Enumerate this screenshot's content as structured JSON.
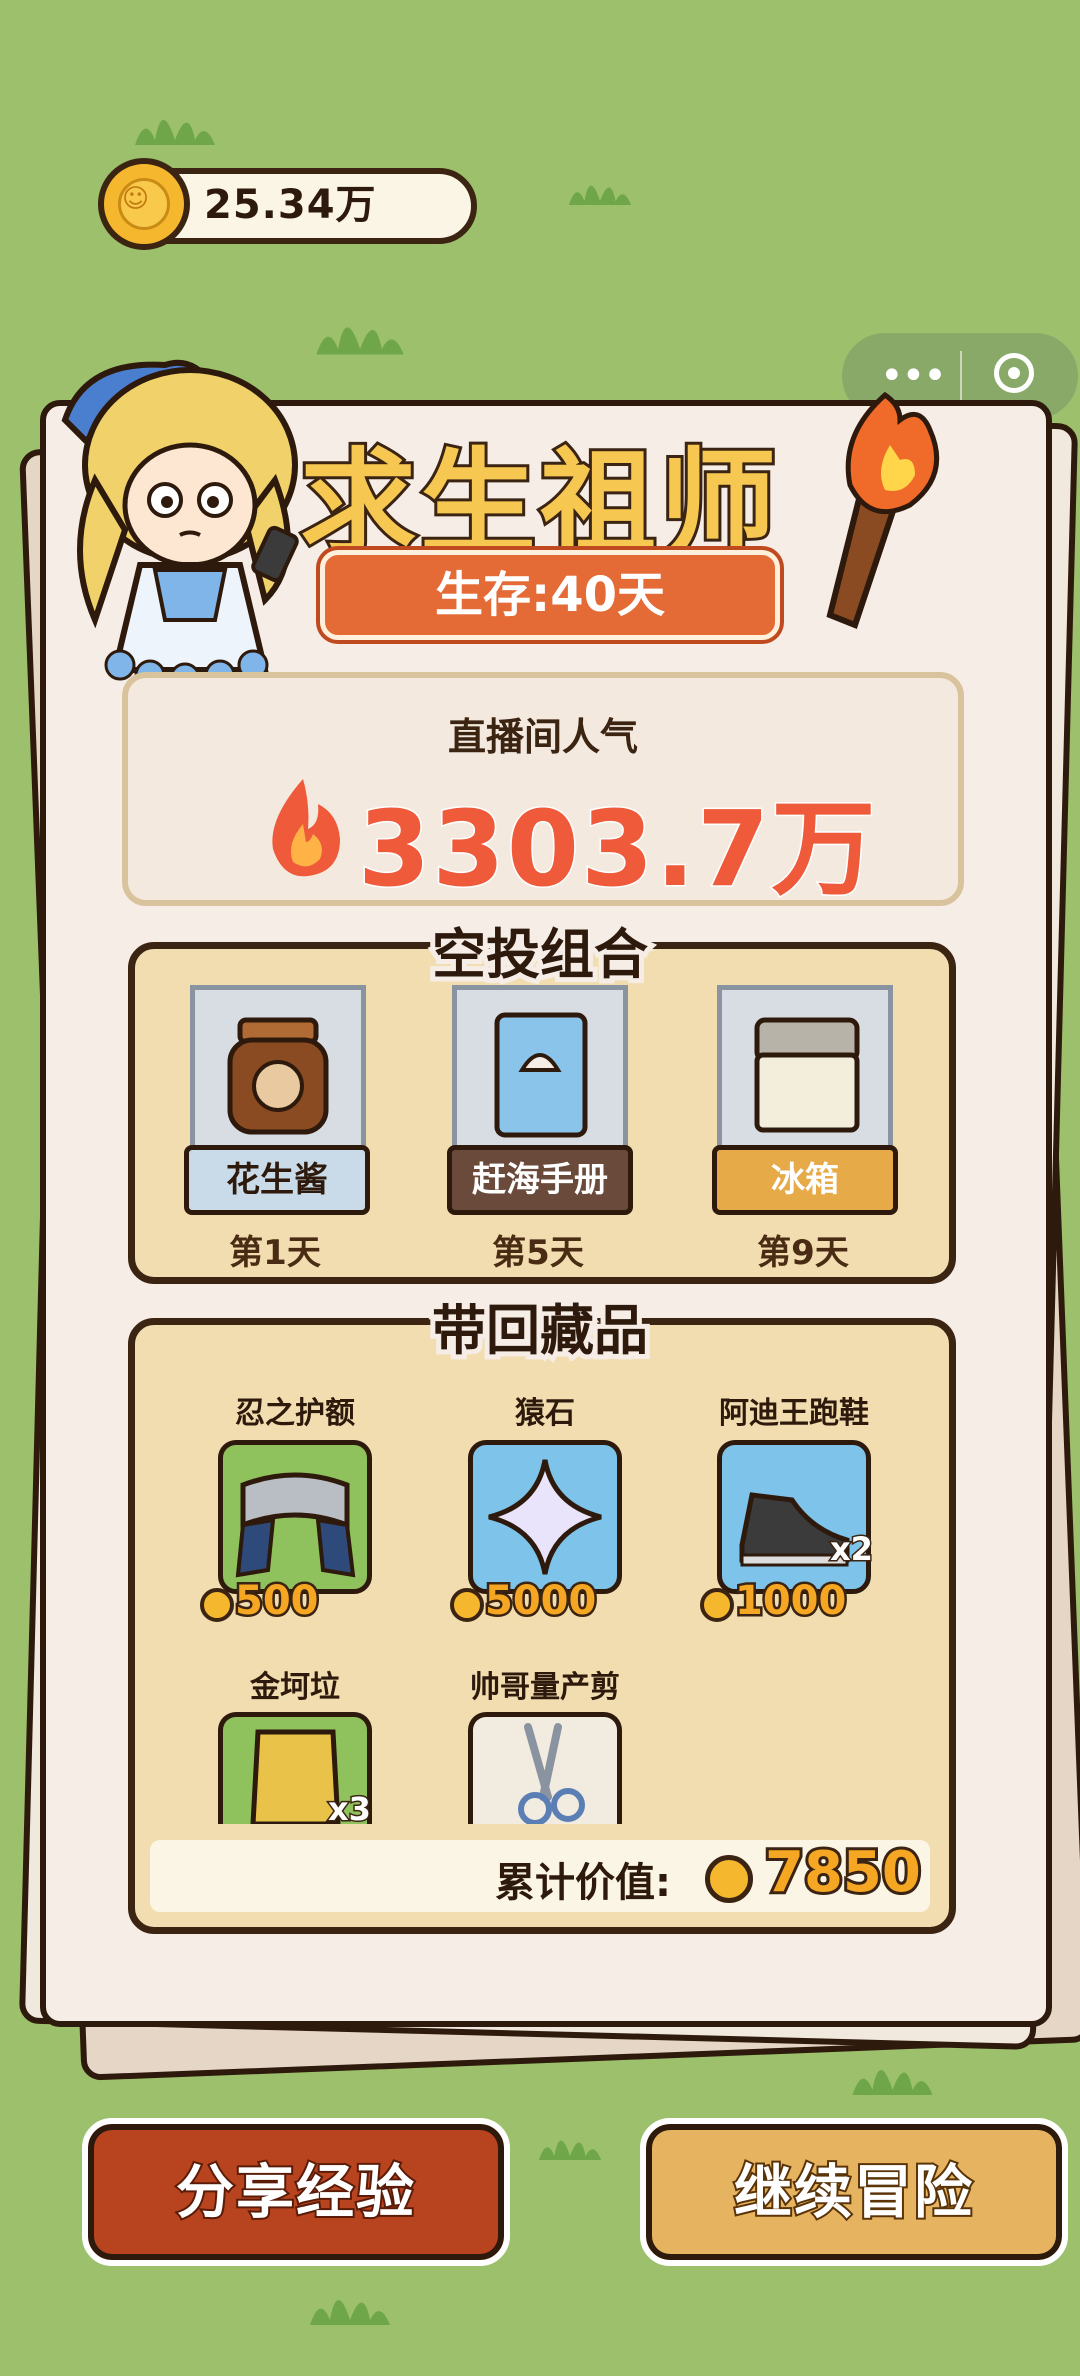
{
  "hud": {
    "coins": "25.34万"
  },
  "capsule": {
    "more_icon": "more-dots-icon",
    "close_icon": "target-icon"
  },
  "header": {
    "title": "求生祖师",
    "survive": "生存:40天"
  },
  "popularity": {
    "label": "直播间人气",
    "value": "3303.7万"
  },
  "airdrop": {
    "title": "空投组合",
    "items": [
      {
        "name": "花生酱",
        "day": "第1天",
        "label_color": "#c9dbe8",
        "label_text_color": "#2e1a0c"
      },
      {
        "name": "赶海手册",
        "day": "第5天",
        "label_color": "#6a4a3a",
        "label_text_color": "#ffffff"
      },
      {
        "name": "冰箱",
        "day": "第9天",
        "label_color": "#e6aa48",
        "label_text_color": "#ffffff"
      }
    ]
  },
  "collection": {
    "title": "带回藏品",
    "items": [
      {
        "name": "忍之护额",
        "price": "500",
        "bg": "#8fc25c"
      },
      {
        "name": "猿石",
        "price": "5000",
        "bg": "#7ec3ea"
      },
      {
        "name": "阿迪王跑鞋",
        "price": "1000",
        "bg": "#7ec3ea",
        "qty": "x2"
      },
      {
        "name": "金坷垃",
        "bg": "#8fc25c",
        "qty": "x3"
      },
      {
        "name": "帅哥量产剪",
        "bg": "#f2ece0"
      }
    ],
    "total_label": "累计价值:",
    "total_value": "7850"
  },
  "buttons": {
    "share": "分享经验",
    "continue": "继续冒险"
  }
}
